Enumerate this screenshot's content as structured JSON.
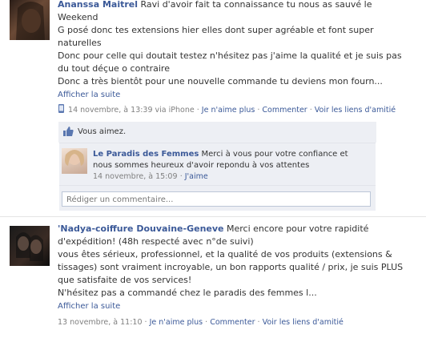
{
  "post1": {
    "author": "Ananssa Maitrel",
    "lines": [
      "Ravi d'avoir fait ta connaissance tu nous as sauvé le",
      "Weekend",
      "G posé donc tes extensions hier elles dont super agréable et font super",
      "naturelles",
      "Donc pour celle qui doutait testez n'hésitez pas j'aime la qualité et je suis pas",
      "du tout déçue o contraire",
      "Donc a très bientôt pour une nouvelle commande tu deviens mon fourn..."
    ],
    "see_more": "Afficher la suite",
    "timestamp": "14 novembre, à 13:39 via iPhone",
    "unlike": "Je n'aime plus",
    "comment": "Commenter",
    "friendship": "Voir les liens d'amitié",
    "likes_text": "Vous aimez.",
    "reply": {
      "author": "Le Paradis des Femmes",
      "text1": "Merci à vous pour votre confiance et",
      "text2": "nous sommes heureux d'avoir repondu à vos attentes",
      "time": "14 novembre, à 15:09",
      "like": "J'aime"
    },
    "comment_placeholder": "Rédiger un commentaire..."
  },
  "post2": {
    "author": "'Nadya-coiffure Douvaine-Geneve",
    "lines": [
      "Merci encore pour votre rapidité",
      "d'expédition! (48h respecté avec n°de suivi)",
      "vous êtes sérieux, professionnel, et la qualité de vos produits (extensions &",
      "tissages) sont vraiment incroyable, un bon rapports qualité / prix, je suis PLUS",
      "que satisfaite de vos services!",
      "N'hésitez pas a commandé chez le paradis des femmes l..."
    ],
    "see_more": "Afficher la suite",
    "timestamp": "13 novembre, à 11:10",
    "unlike": "Je n'aime plus",
    "comment": "Commenter",
    "friendship": "Voir les liens d'amitié"
  },
  "colors": {
    "link": "#3b5998",
    "likes_bg": "#edeff4",
    "border": "#bdc7d8"
  }
}
